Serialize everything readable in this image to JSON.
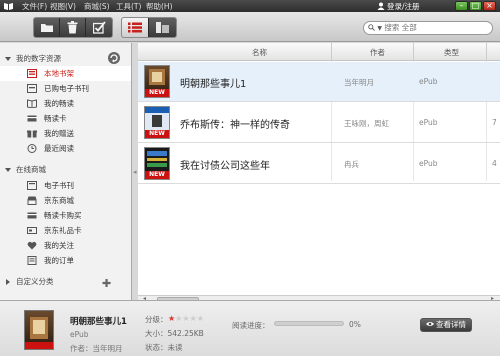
{
  "menu": {
    "file": "文件(F)",
    "view": "视图(V)",
    "store": "商城(S)",
    "tools": "工具(T)",
    "help": "帮助(H)",
    "login": "登录/注册"
  },
  "search": {
    "placeholder": "搜索 全部"
  },
  "sidebar": {
    "section1": {
      "title": "我的数字资源",
      "items": [
        {
          "label": "本地书架",
          "icon": "bookshelf-icon",
          "selected": true
        },
        {
          "label": "已购电子书刊",
          "icon": "purchased-icon"
        },
        {
          "label": "我的畅读",
          "icon": "reading-icon"
        },
        {
          "label": "畅读卡",
          "icon": "card-icon"
        },
        {
          "label": "我的赠送",
          "icon": "gift-icon"
        },
        {
          "label": "最近阅读",
          "icon": "clock-icon"
        }
      ]
    },
    "section2": {
      "title": "在线商城",
      "items": [
        {
          "label": "电子书刊",
          "icon": "ebook-icon"
        },
        {
          "label": "京东商城",
          "icon": "store-icon"
        },
        {
          "label": "畅读卡购买",
          "icon": "buy-card-icon"
        },
        {
          "label": "京东礼品卡",
          "icon": "giftcard-icon"
        },
        {
          "label": "我的关注",
          "icon": "heart-icon"
        },
        {
          "label": "我的订单",
          "icon": "order-icon"
        }
      ]
    },
    "section3": {
      "title": "自定义分类"
    }
  },
  "table": {
    "headers": {
      "name": "名称",
      "author": "作者",
      "type": "类型"
    },
    "rows": [
      {
        "title": "明朝那些事儿1",
        "author": "当年明月",
        "type": "ePub",
        "extra": "",
        "new_tag": "NEW",
        "selected": true
      },
      {
        "title": "乔布斯传：神一样的传奇",
        "author": "王咏刚，周虹",
        "type": "ePub",
        "extra": "7",
        "new_tag": "NEW"
      },
      {
        "title": "我在讨债公司这些年",
        "author": "冉兵",
        "type": "ePub",
        "extra": "4",
        "new_tag": "NEW"
      }
    ]
  },
  "details": {
    "title": "明朝那些事儿1",
    "type": "ePub",
    "author_label": "作者：当年明月",
    "rating_label": "分级：",
    "rating": 1,
    "rating_max": 5,
    "size_label": "大小：542.25KB",
    "status_label": "状态：未读",
    "progress_label": "阅读进度：",
    "progress_value": "0%",
    "progress": 0,
    "view_button": "查看详情"
  },
  "colors": {
    "accent_red": "#c8201a",
    "selection_blue": "#e5f0fb"
  }
}
